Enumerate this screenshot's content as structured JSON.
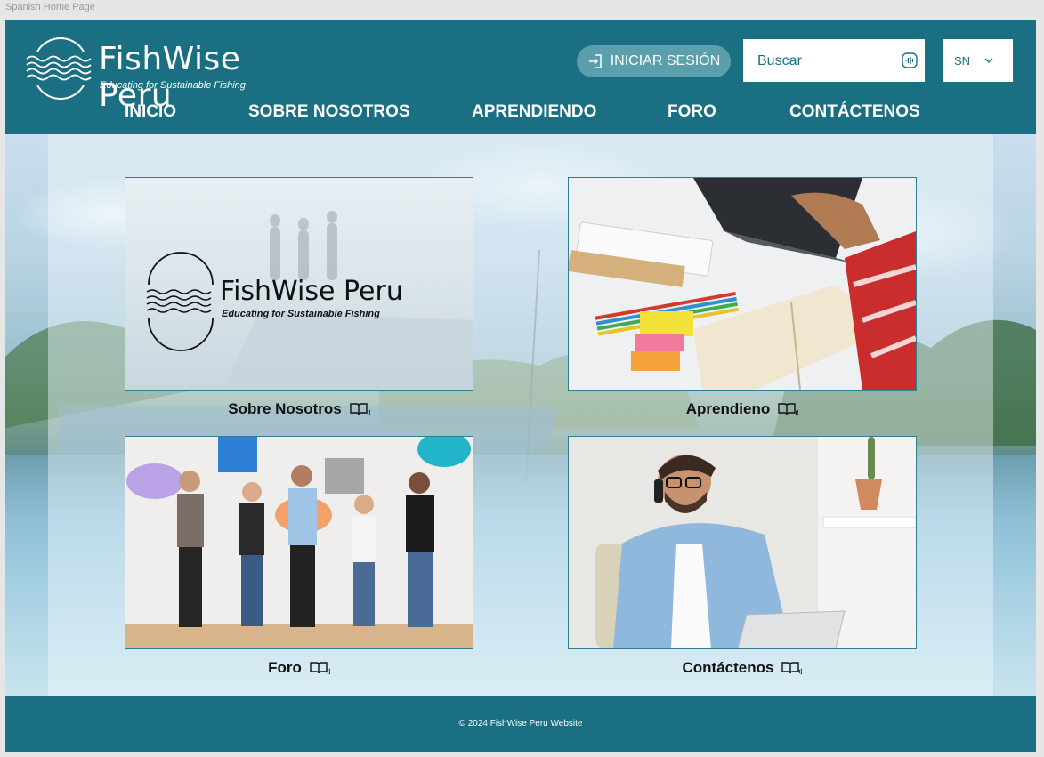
{
  "frame": {
    "label": "Spanish Home Page"
  },
  "header": {
    "brand_name": "FishWise Peru",
    "brand_tagline": "Educating for Sustainable Fishing",
    "login_label": "INICIAR SESIÓN",
    "search_placeholder": "Buscar",
    "language": "SN"
  },
  "nav": {
    "items": [
      {
        "label": "INICIO"
      },
      {
        "label": "SOBRE NOSOTROS"
      },
      {
        "label": "APRENDIENDO"
      },
      {
        "label": "FORO"
      },
      {
        "label": "CONTÁCTENOS"
      }
    ]
  },
  "cards": [
    {
      "label": "Sobre Nosotros",
      "logo_name": "FishWise Peru",
      "logo_tagline": "Educating for Sustainable Fishing"
    },
    {
      "label": "Aprendieno"
    },
    {
      "label": "Foro"
    },
    {
      "label": "Contáctenos"
    }
  ],
  "footer": {
    "copyright": "© 2024 FishWise Peru Website"
  },
  "colors": {
    "brand": "#1a6f82",
    "login_button": "#5b9fad",
    "white": "#ffffff"
  },
  "icons": [
    "waves-logo-icon",
    "login-icon",
    "voice-icon",
    "chevron-down-icon",
    "read-aloud-icon"
  ]
}
